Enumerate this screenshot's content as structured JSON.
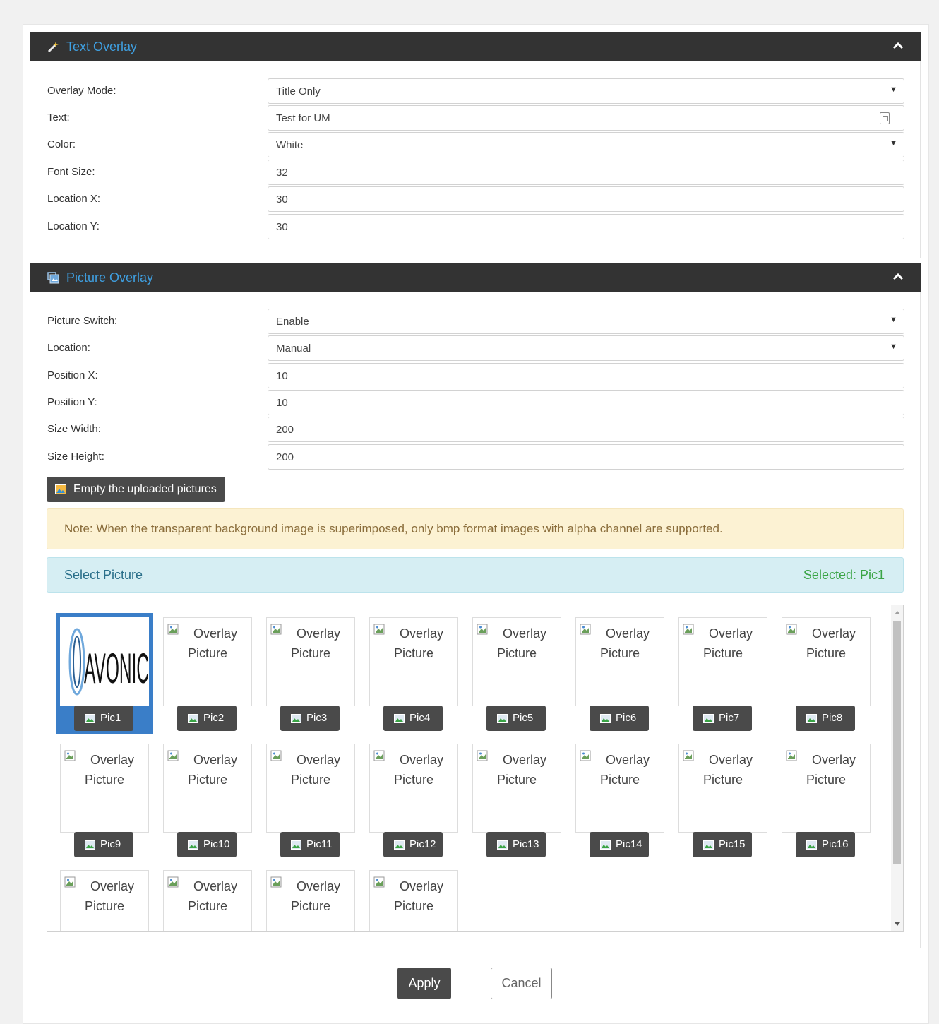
{
  "text_overlay": {
    "title": "Text Overlay",
    "fields": [
      {
        "label": "Overlay Mode:",
        "value": "Title Only",
        "type": "select"
      },
      {
        "label": "Text:",
        "value": "Test for UM",
        "type": "text"
      },
      {
        "label": "Color:",
        "value": "White",
        "type": "select"
      },
      {
        "label": "Font Size:",
        "value": "32",
        "type": "text"
      },
      {
        "label": "Location X:",
        "value": "30",
        "type": "text"
      },
      {
        "label": "Location Y:",
        "value": "30",
        "type": "text"
      }
    ]
  },
  "picture_overlay": {
    "title": "Picture Overlay",
    "fields": [
      {
        "label": "Picture Switch:",
        "value": "Enable",
        "type": "select"
      },
      {
        "label": "Location:",
        "value": "Manual",
        "type": "select"
      },
      {
        "label": "Position X:",
        "value": "10",
        "type": "text"
      },
      {
        "label": "Position Y:",
        "value": "10",
        "type": "text"
      },
      {
        "label": "Size Width:",
        "value": "200",
        "type": "text"
      },
      {
        "label": "Size Height:",
        "value": "200",
        "type": "text"
      }
    ],
    "empty_button": "Empty the uploaded pictures",
    "note": "Note: When the transparent background image is superimposed, only bmp format images with alpha channel are supported.",
    "select_label": "Select Picture",
    "selected_text": "Selected: Pic1",
    "placeholder_line1": "Overlay",
    "placeholder_line2": "Picture",
    "logo_text": "AVONIC",
    "pictures": [
      "Pic1",
      "Pic2",
      "Pic3",
      "Pic4",
      "Pic5",
      "Pic6",
      "Pic7",
      "Pic8",
      "Pic9",
      "Pic10",
      "Pic11",
      "Pic12",
      "Pic13",
      "Pic14",
      "Pic15",
      "Pic16",
      "",
      "",
      "",
      ""
    ]
  },
  "actions": {
    "apply": "Apply",
    "cancel": "Cancel"
  },
  "colors": {
    "header_bg": "#333333",
    "header_text": "#3f9fe0",
    "selected": "#3a7ec8",
    "note_bg": "#fcf2d3",
    "info_bg": "#d6eef3",
    "success": "#3aa445"
  }
}
